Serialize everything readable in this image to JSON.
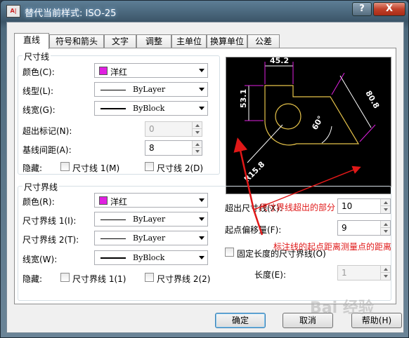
{
  "window": {
    "title": "替代当前样式: ISO-25",
    "help_btn": "?",
    "close_btn": "X",
    "app_icon": "A|"
  },
  "tabs": [
    "直线",
    "符号和箭头",
    "文字",
    "调整",
    "主单位",
    "换算单位",
    "公差"
  ],
  "dim_line": {
    "title": "尺寸线",
    "color_label": "颜色(C):",
    "color_value": "洋红",
    "linetype_label": "线型(L):",
    "linetype_value": "ByLayer",
    "lineweight_label": "线宽(G):",
    "lineweight_value": "ByBlock",
    "extend_ticks_label": "超出标记(N):",
    "extend_ticks_value": "0",
    "baseline_spacing_label": "基线间距(A):",
    "baseline_spacing_value": "8",
    "suppress_label": "隐藏:",
    "suppress1": "尺寸线 1(M)",
    "suppress2": "尺寸线 2(D)"
  },
  "ext_line": {
    "title": "尺寸界线",
    "color_label": "颜色(R):",
    "color_value": "洋红",
    "linetype1_label": "尺寸界线 1(I):",
    "linetype1_value": "ByLayer",
    "linetype2_label": "尺寸界线 2(T):",
    "linetype2_value": "ByLayer",
    "lineweight_label": "线宽(W):",
    "lineweight_value": "ByBlock",
    "suppress_label": "隐藏:",
    "suppress1": "尺寸界线 1(1)",
    "suppress2": "尺寸界线 2(2)",
    "extend_label": "超出尺寸线(X):",
    "extend_value": "10",
    "offset_label": "起点偏移量(F):",
    "offset_value": "9",
    "fixed_length_label": "固定长度的尺寸界线(O)",
    "length_label": "长度(E):",
    "length_value": "1"
  },
  "preview": {
    "dim_top": "45.2",
    "dim_left": "53.1",
    "dim_right": "80.8",
    "dim_angle": "60°",
    "dim_radius": "R15.8"
  },
  "annotations": {
    "note1": "尺寸界线超出的部分",
    "note2": "标注线的起点距离测量点的距离"
  },
  "buttons": {
    "ok": "确定",
    "cancel": "取消",
    "help": "帮助(H)"
  },
  "watermark": "Bai 经验",
  "colors": {
    "magenta": "#e020e0",
    "preview_bg": "#000000",
    "geometry": "#e6c34a",
    "annotation": "#e01818"
  }
}
